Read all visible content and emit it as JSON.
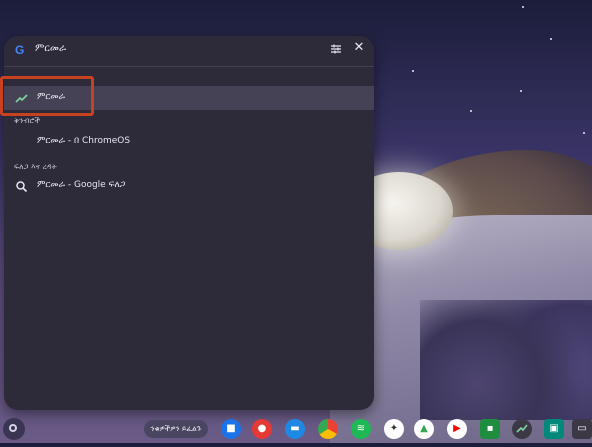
{
  "search": {
    "query": "ምርመራ"
  },
  "results": {
    "top": {
      "label": "ምርመራ",
      "icon": "trending-icon"
    },
    "sections": [
      {
        "label": "ቅንብሮች",
        "items": [
          {
            "label": "ምርመራ - በ ChromeOS",
            "icon": "settings-gear-icon"
          }
        ]
      },
      {
        "label": "ፍለጋ እና ረዳት",
        "items": [
          {
            "label": "ምርመራ - Google ፍለጋ",
            "icon": "search-icon"
          }
        ]
      }
    ]
  },
  "shelf": {
    "pill_label": "ንቁዎችዎን ይፈልጉ",
    "apps": [
      {
        "name": "camera",
        "color": "#1a73e8"
      },
      {
        "name": "help",
        "color": "#e53935"
      },
      {
        "name": "files",
        "color": "#1e88e5"
      },
      {
        "name": "chrome",
        "color": "#fbbc04"
      },
      {
        "name": "spotify",
        "color": "#1db954"
      },
      {
        "name": "media-app",
        "color": "#ffffff"
      },
      {
        "name": "google-drive",
        "color": "#34a853"
      },
      {
        "name": "youtube",
        "color": "#ff0000"
      },
      {
        "name": "classroom",
        "color": "#1e8e3e"
      },
      {
        "name": "diagnostics",
        "color": "#3c3846"
      },
      {
        "name": "meet",
        "color": "#00897b"
      },
      {
        "name": "overview",
        "color": "#3c3846"
      }
    ]
  },
  "colors": {
    "accent": "#8ab4f8",
    "highlight": "#c8421f"
  }
}
